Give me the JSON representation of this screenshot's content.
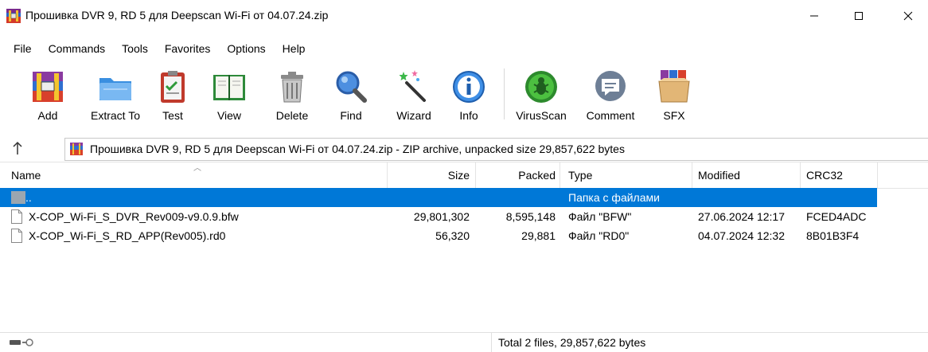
{
  "window": {
    "title": "Прошивка DVR 9, RD 5 для Deepscan Wi-Fi от 04.07.24.zip"
  },
  "menu": {
    "items": [
      {
        "label": "File"
      },
      {
        "label": "Commands"
      },
      {
        "label": "Tools"
      },
      {
        "label": "Favorites"
      },
      {
        "label": "Options"
      },
      {
        "label": "Help"
      }
    ]
  },
  "toolbar": {
    "buttons": [
      {
        "label": "Add",
        "icon": "add-icon"
      },
      {
        "label": "Extract To",
        "icon": "extract-folder-icon"
      },
      {
        "label": "Test",
        "icon": "test-clipboard-icon"
      },
      {
        "label": "View",
        "icon": "view-book-icon"
      },
      {
        "label": "Delete",
        "icon": "trash-icon"
      },
      {
        "label": "Find",
        "icon": "magnifier-icon"
      },
      {
        "label": "Wizard",
        "icon": "wizard-wand-icon"
      },
      {
        "label": "Info",
        "icon": "info-icon"
      },
      {
        "label": "VirusScan",
        "icon": "virus-scan-icon"
      },
      {
        "label": "Comment",
        "icon": "comment-icon"
      },
      {
        "label": "SFX",
        "icon": "sfx-box-icon"
      }
    ]
  },
  "address": {
    "text": "Прошивка DVR 9, RD 5 для Deepscan Wi-Fi от 04.07.24.zip - ZIP archive, unpacked size 29,857,622 bytes"
  },
  "table": {
    "columns": {
      "name": "Name",
      "size": "Size",
      "packed": "Packed",
      "type": "Type",
      "modified": "Modified",
      "crc": "CRC32"
    },
    "rows": [
      {
        "name": "..",
        "size": "",
        "packed": "",
        "type": "Папка с файлами",
        "modified": "",
        "crc": "",
        "selected": true
      },
      {
        "name": "X-COP_Wi-Fi_S_DVR_Rev009-v9.0.9.bfw",
        "size": "29,801,302",
        "packed": "8,595,148",
        "type": "Файл \"BFW\"",
        "modified": "27.06.2024 12:17",
        "crc": "FCED4ADC",
        "selected": false
      },
      {
        "name": "X-COP_Wi-Fi_S_RD_APP(Rev005).rd0",
        "size": "56,320",
        "packed": "29,881",
        "type": "Файл \"RD0\"",
        "modified": "04.07.2024 12:32",
        "crc": "8B01B3F4",
        "selected": false
      }
    ]
  },
  "status": {
    "text": "Total 2 files, 29,857,622 bytes"
  },
  "colors": {
    "selection": "#0078d7",
    "header_border": "#e4e4e4"
  }
}
